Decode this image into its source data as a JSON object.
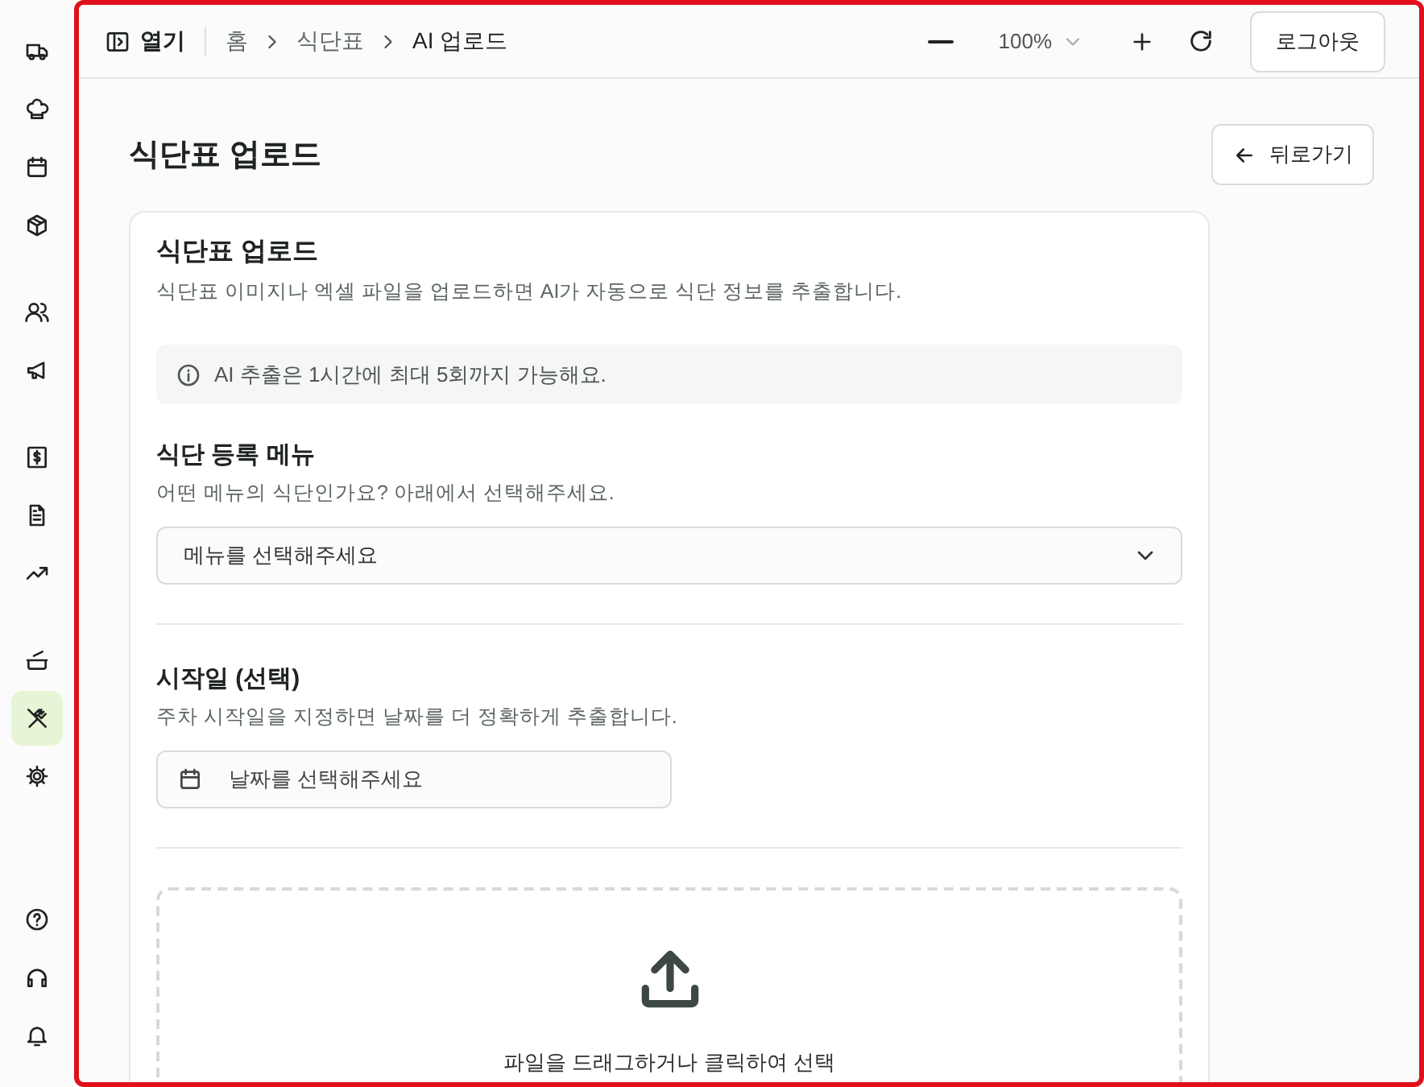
{
  "sidebar": {
    "groups": [
      [
        {
          "selected": false
        },
        {
          "selected": false
        },
        {
          "selected": false
        },
        {
          "selected": false
        }
      ],
      [
        {
          "selected": false
        },
        {
          "selected": false
        }
      ],
      [
        {
          "selected": false
        },
        {
          "selected": false
        },
        {
          "selected": false
        }
      ],
      [
        {
          "selected": false
        },
        {
          "selected": true
        },
        {
          "selected": false
        }
      ],
      [
        {
          "selected": false
        },
        {
          "selected": false
        },
        {
          "selected": false
        }
      ]
    ]
  },
  "topbar": {
    "toggle_label": "열기",
    "breadcrumbs": [
      "홈",
      "식단표",
      "AI 업로드"
    ],
    "zoom": "100%",
    "logout": "로그아웃"
  },
  "page": {
    "title": "식단표 업로드",
    "back": "뒤로가기"
  },
  "card": {
    "title": "식단표 업로드",
    "description": "식단표 이미지나 엑셀 파일을 업로드하면 AI가 자동으로 식단 정보를 추출합니다.",
    "notice": "AI 추출은 1시간에 최대 5회까지 가능해요.",
    "menu_section": {
      "title": "식단 등록 메뉴",
      "description": "어떤 메뉴의 식단인가요? 아래에서 선택해주세요.",
      "placeholder": "메뉴를 선택해주세요"
    },
    "date_section": {
      "title": "시작일 (선택)",
      "description": "주차 시작일을 지정하면 날짜를 더 정확하게 추출합니다.",
      "placeholder": "날짜를 선택해주세요"
    },
    "dropzone": {
      "text": "파일을 드래그하거나 클릭하여 선택"
    }
  }
}
